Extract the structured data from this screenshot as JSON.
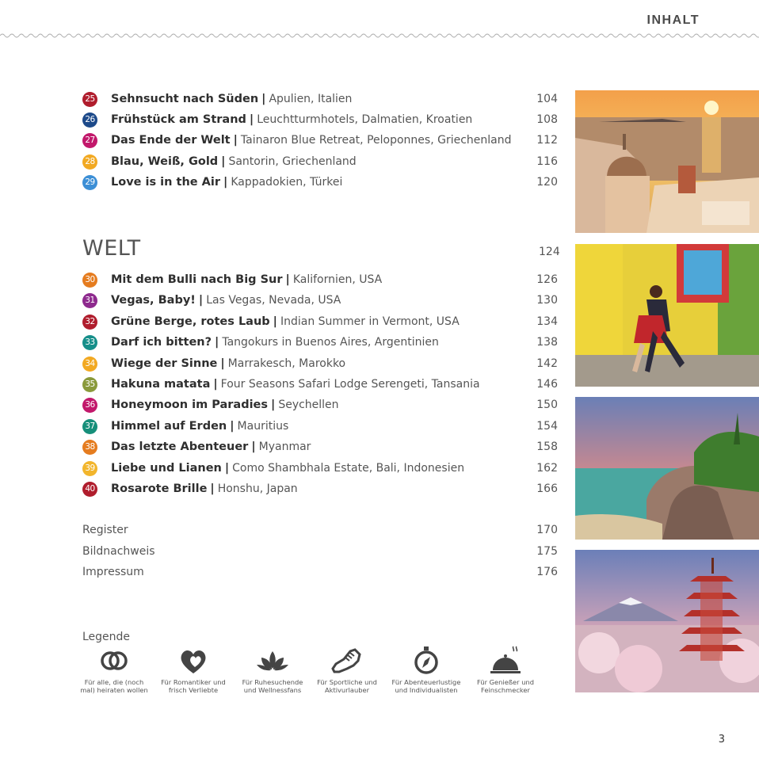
{
  "header": {
    "title": "INHALT"
  },
  "section_europe": {
    "entries": [
      {
        "num": "25",
        "title": "Sehnsucht nach Süden",
        "subtitle": "Apulien, Italien",
        "page": "104",
        "color": "#b01d2d"
      },
      {
        "num": "26",
        "title": "Frühstück am Strand",
        "subtitle": "Leuchtturmhotels, Dalmatien, Kroatien",
        "page": "108",
        "color": "#1d4a8a"
      },
      {
        "num": "27",
        "title": "Das Ende der Welt",
        "subtitle": "Tainaron Blue Retreat, Peloponnes, Griechenland",
        "page": "112",
        "color": "#c2186b"
      },
      {
        "num": "28",
        "title": "Blau, Weiß, Gold",
        "subtitle": "Santorin, Griechenland",
        "page": "116",
        "color": "#f2a922"
      },
      {
        "num": "29",
        "title": "Love is in the Air",
        "subtitle": "Kappadokien, Türkei",
        "page": "120",
        "color": "#3c8fd6"
      }
    ]
  },
  "section_welt": {
    "heading": "WELT",
    "page": "124",
    "entries": [
      {
        "num": "30",
        "title": "Mit dem Bulli nach Big Sur",
        "subtitle": "Kalifornien, USA",
        "page": "126",
        "color": "#e57c1f"
      },
      {
        "num": "31",
        "title": "Vegas, Baby!",
        "subtitle": "Las Vegas, Nevada, USA",
        "page": "130",
        "color": "#8e2a8e"
      },
      {
        "num": "32",
        "title": "Grüne Berge, rotes Laub",
        "subtitle": "Indian Summer in Vermont, USA",
        "page": "134",
        "color": "#b01d2d"
      },
      {
        "num": "33",
        "title": "Darf ich bitten?",
        "subtitle": "Tangokurs in Buenos Aires, Argentinien",
        "page": "138",
        "color": "#168f8a"
      },
      {
        "num": "34",
        "title": "Wiege der Sinne",
        "subtitle": "Marrakesch, Marokko",
        "page": "142",
        "color": "#f2a922"
      },
      {
        "num": "35",
        "title": "Hakuna matata",
        "subtitle": "Four Seasons Safari Lodge Serengeti, Tansania",
        "page": "146",
        "color": "#8a9a3b"
      },
      {
        "num": "36",
        "title": "Honeymoon im Paradies",
        "subtitle": "Seychellen",
        "page": "150",
        "color": "#c2186b"
      },
      {
        "num": "37",
        "title": "Himmel auf Erden",
        "subtitle": "Mauritius",
        "page": "154",
        "color": "#168f7a"
      },
      {
        "num": "38",
        "title": "Das letzte Abenteuer",
        "subtitle": "Myanmar",
        "page": "158",
        "color": "#e57c1f"
      },
      {
        "num": "39",
        "title": "Liebe und Lianen",
        "subtitle": "Como Shambhala Estate, Bali, Indonesien",
        "page": "162",
        "color": "#f2b52c"
      },
      {
        "num": "40",
        "title": "Rosarote Brille",
        "subtitle": "Honshu, Japan",
        "page": "166",
        "color": "#b01d2d"
      }
    ]
  },
  "appendix": [
    {
      "label": "Register",
      "page": "170"
    },
    {
      "label": "Bildnachweis",
      "page": "175"
    },
    {
      "label": "Impressum",
      "page": "176"
    }
  ],
  "legend": {
    "title": "Legende",
    "items": [
      {
        "icon": "rings-icon",
        "line1": "Für alle, die (noch",
        "line2": "mal) heiraten wollen"
      },
      {
        "icon": "hearts-icon",
        "line1": "Für Romantiker und",
        "line2": "frisch Verliebte"
      },
      {
        "icon": "lotus-icon",
        "line1": "Für Ruhesuchende",
        "line2": "und Wellnessfans"
      },
      {
        "icon": "sneaker-icon",
        "line1": "Für Sportliche und",
        "line2": "Aktivurlauber"
      },
      {
        "icon": "compass-icon",
        "line1": "Für Abenteuerlustige",
        "line2": "und Individualisten"
      },
      {
        "icon": "cloche-icon",
        "line1": "Für Genießer und",
        "line2": "Feinschmecker"
      }
    ]
  },
  "page_number": "3"
}
